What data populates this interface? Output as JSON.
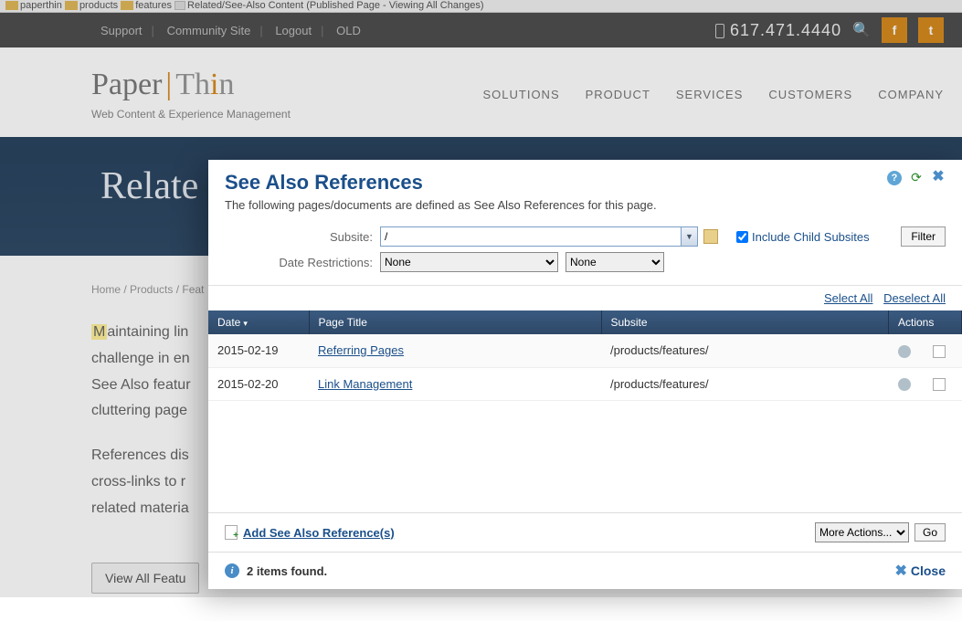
{
  "crumbStrip": {
    "items": [
      "paperthin",
      "products",
      "features"
    ],
    "page": "Related/See-Also Content (Published Page - Viewing All Changes)"
  },
  "utilNav": {
    "support": "Support",
    "community": "Community Site",
    "logout": "Logout",
    "old": "OLD"
  },
  "phone": "617.471.4440",
  "social": {
    "fb": "f",
    "tw": "t"
  },
  "logo": {
    "paper": "Paper",
    "thin": "Th",
    "in": "n",
    "tag": "Web Content & Experience Management"
  },
  "mainNav": [
    "SOLUTIONS",
    "PRODUCT",
    "SERVICES",
    "CUSTOMERS",
    "COMPANY"
  ],
  "heroTitle": "Relate",
  "breadcrumb2": "Home / Products / Feat",
  "bodyP1Lead": "aintaining lin",
  "bodyP1Rest": "challenge in en\nSee Also featur\ncluttering page",
  "bodyP2": "References dis\ncross-links to r\nrelated materia",
  "viewAllBtn": "View All Featu",
  "dialog": {
    "title": "See Also References",
    "subtitle": "The following pages/documents are defined as See Also References for this page.",
    "filter": {
      "subsiteLabel": "Subsite:",
      "subsiteValue": "/",
      "includeLabel": "Include Child Subsites",
      "includeChecked": true,
      "filterBtn": "Filter",
      "dateLabel": "Date Restrictions:",
      "dateFrom": "None",
      "dateTo": "None"
    },
    "selectAll": "Select All",
    "deselectAll": "Deselect All",
    "cols": {
      "date": "Date",
      "title": "Page Title",
      "subsite": "Subsite",
      "actions": "Actions"
    },
    "rows": [
      {
        "date": "2015-02-19",
        "title": "Referring Pages",
        "subsite": "/products/features/"
      },
      {
        "date": "2015-02-20",
        "title": "Link Management",
        "subsite": "/products/features/"
      }
    ],
    "addLink": "Add See Also Reference(s)",
    "moreActions": "More Actions...",
    "go": "Go",
    "statusText": "2 items found.",
    "close": "Close"
  }
}
